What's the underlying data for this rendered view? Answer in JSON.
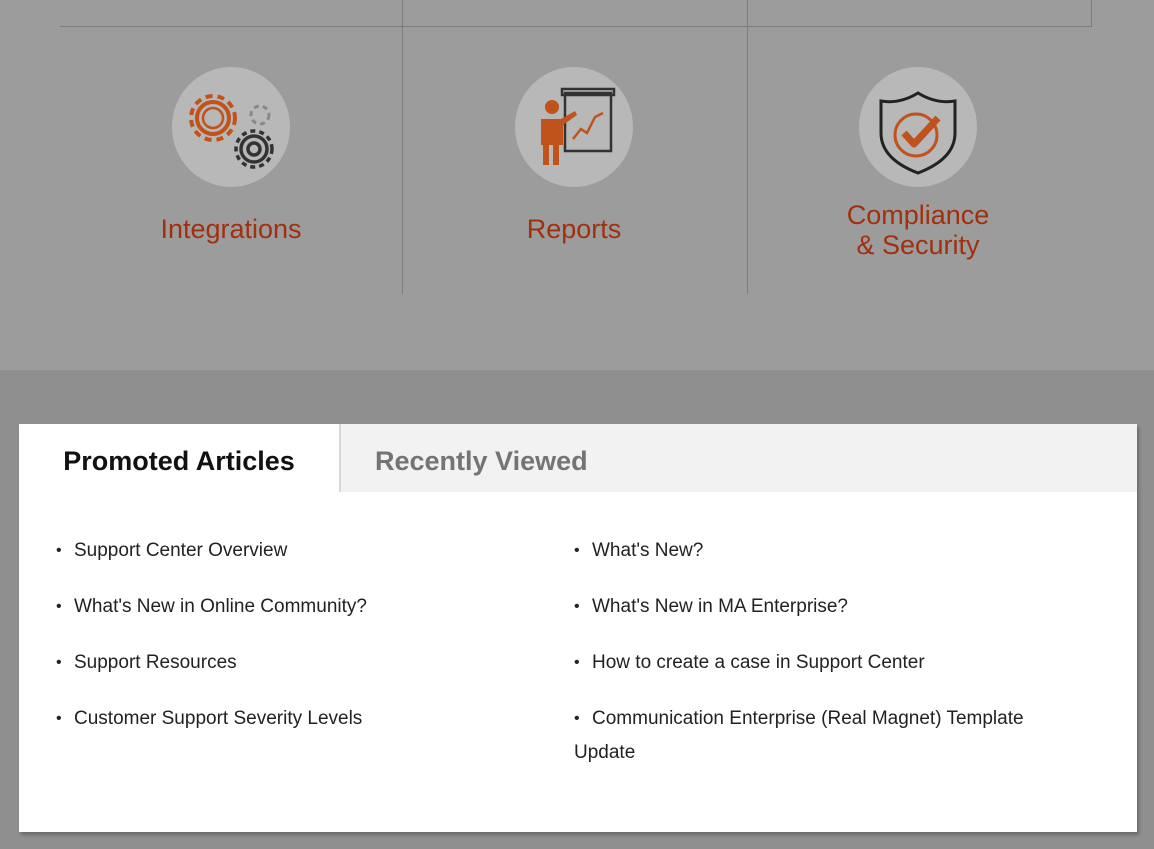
{
  "features": [
    {
      "label_lines": [
        "Integrations"
      ],
      "icon": "gears-icon"
    },
    {
      "label_lines": [
        "Reports"
      ],
      "icon": "presentation-chart-icon"
    },
    {
      "label_lines": [
        "Compliance",
        "& Security"
      ],
      "icon": "shield-check-icon"
    }
  ],
  "colors": {
    "accent": "#a0300f",
    "icon_orange": "#c0521c",
    "top_background": "#9c9c9c",
    "bottom_background": "#8f8f8f"
  },
  "tabs": {
    "promoted": "Promoted Articles",
    "recent": "Recently Viewed"
  },
  "promoted_articles": {
    "left": [
      "Support Center Overview",
      "What's New in Online Community?",
      "Support Resources",
      "Customer Support Severity Levels"
    ],
    "right": [
      "What's New?",
      "What's New in MA Enterprise?",
      "How to create a case in Support Center",
      "Communication Enterprise (Real Magnet) Template Update"
    ]
  },
  "bullet": "•"
}
